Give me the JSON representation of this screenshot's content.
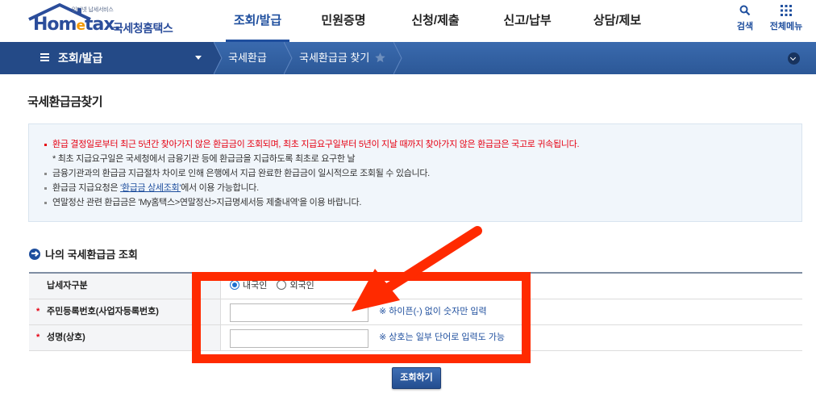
{
  "header": {
    "logo": {
      "subtitle": "인터넷 납세서비스",
      "brand_prefix": "Hom",
      "brand_e": "e",
      "brand_suffix": "tax.",
      "name": "국세청홈택스"
    },
    "nav": [
      {
        "label": "조회/발급",
        "active": true
      },
      {
        "label": "민원증명",
        "active": false
      },
      {
        "label": "신청/제출",
        "active": false
      },
      {
        "label": "신고/납부",
        "active": false
      },
      {
        "label": "상담/제보",
        "active": false
      }
    ],
    "search_label": "검색",
    "all_menu_label": "전체메뉴"
  },
  "location": {
    "menu_label": "조회/발급",
    "crumbs": [
      "국세환급",
      "국세환급금 찾기"
    ]
  },
  "page": {
    "title": "국세환급금찾기"
  },
  "notice": {
    "line1": "환급 결정일로부터 최근 5년간 찾아가지 않은 환급금이 조회되며, 최초 지급요구일부터 5년이 지날 때까지 찾아가지 않은 환급금은 국고로 귀속됩니다.",
    "line2": "* 최초 지급요구일은 국세청에서 금융기관 등에 환급금을 지급하도록 최초로 요구한 날",
    "line3": "금융기관과의 환급금 지급절차 차이로 인해 은행에서 지급 완료한 환급금이 일시적으로 조회될 수 있습니다.",
    "line4_prefix": "환급금 지급요청은 ",
    "line4_link": "'환급금 상세조회'",
    "line4_suffix": "에서 이용 가능합니다.",
    "line5": "연말정산 관련 환급금은 'My홈택스>연말정산>지급명세서등 제출내역'을 이용 바랍니다."
  },
  "lookup": {
    "section_title": "나의 국세환급금 조회",
    "taxpayer_type": {
      "label": "납세자구분",
      "options": [
        "내국인",
        "외국인"
      ],
      "selected": "내국인"
    },
    "id_number": {
      "required_mark": "*",
      "label": "주민등록번호(사업자등록번호)",
      "value": "",
      "hint": "※ 하이픈(-) 없이 숫자만 입력"
    },
    "name": {
      "required_mark": "*",
      "label": "성명(상호)",
      "value": "",
      "hint": "※ 상호는 일부 단어로 입력도 가능"
    },
    "submit_label": "조회하기"
  },
  "colors": {
    "brand_blue": "#1f4f9e",
    "location_bar": "#2c5897",
    "notice_red": "#e60012",
    "annotation_red": "#ff2a00"
  }
}
